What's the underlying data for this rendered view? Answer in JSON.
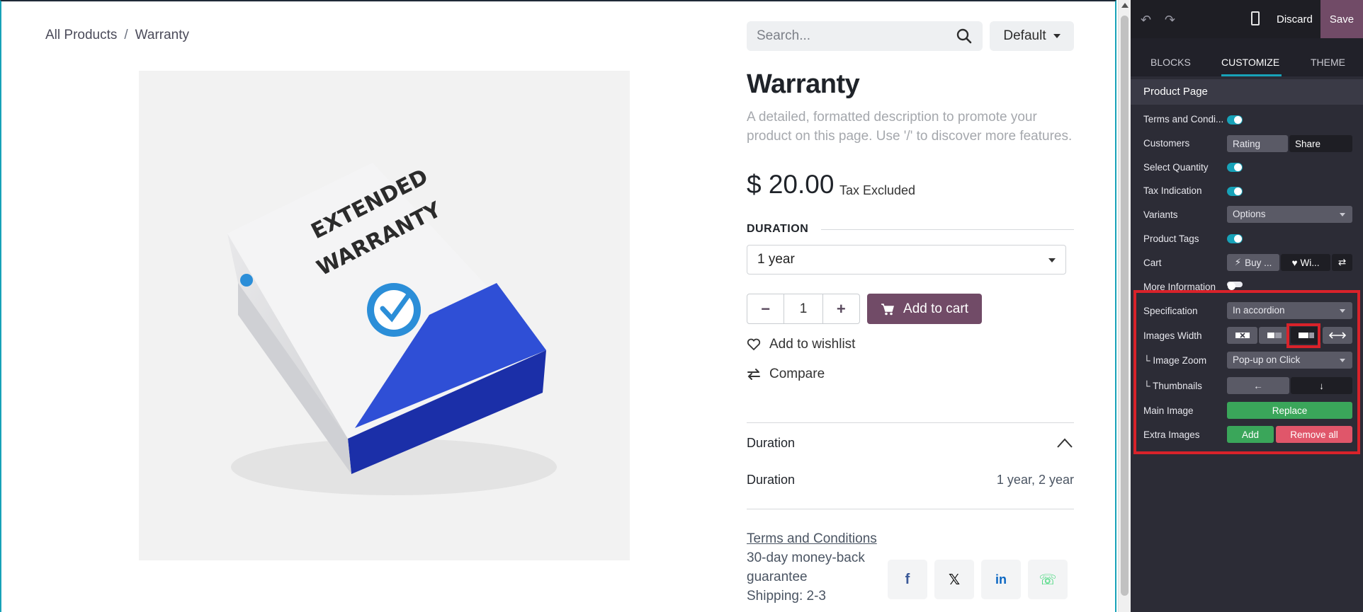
{
  "breadcrumb": {
    "root": "All Products",
    "separator": "/",
    "current": "Warranty"
  },
  "search": {
    "placeholder": "Search...",
    "icon": "search-icon"
  },
  "sort": {
    "label": "Default"
  },
  "product": {
    "image_title_line1": "EXTENDED",
    "image_title_line2": "WARRANTY",
    "name": "Warranty",
    "description": "A detailed, formatted description to promote your product on this page. Use '/' to discover more features.",
    "price": "$ 20.00",
    "tax_note": "Tax Excluded",
    "attribute_label": "DURATION",
    "attribute_value": "1 year",
    "quantity": "1",
    "add_to_cart": "Add to cart",
    "wishlist": "Add to wishlist",
    "compare": "Compare",
    "accordion_title": "Duration",
    "spec_name": "Duration",
    "spec_value": "1 year, 2 year",
    "terms_link": "Terms and Conditions",
    "guarantee": "30-day money-back guarantee",
    "shipping": "Shipping: 2-3",
    "share_icons": [
      "facebook-icon",
      "x-icon",
      "linkedin-icon",
      "whatsapp-icon"
    ]
  },
  "editor": {
    "discard": "Discard",
    "save": "Save",
    "tabs": {
      "blocks": "BLOCKS",
      "customize": "CUSTOMIZE",
      "theme": "THEME"
    },
    "section": "Product Page",
    "rows": {
      "terms": "Terms and Condi...",
      "customers": "Customers",
      "customers_rating": "Rating",
      "customers_share": "Share",
      "select_quantity": "Select Quantity",
      "tax_indication": "Tax Indication",
      "variants": "Variants",
      "variants_value": "Options",
      "product_tags": "Product Tags",
      "cart": "Cart",
      "cart_buy": "Buy ...",
      "cart_wish": "Wi...",
      "more_information": "More Information",
      "specification": "Specification",
      "specification_value": "In accordion",
      "images_width": "Images Width",
      "image_zoom": "└ Image Zoom",
      "image_zoom_value": "Pop-up on Click",
      "thumbnails": "└ Thumbnails",
      "main_image": "Main Image",
      "replace": "Replace",
      "extra_images": "Extra Images",
      "add": "Add",
      "remove_all": "Remove all"
    }
  },
  "colors": {
    "accent": "#714b67",
    "teal": "#17a2b8",
    "highlight": "#d9222a",
    "green": "#3aa65a",
    "red": "#e0566a"
  }
}
